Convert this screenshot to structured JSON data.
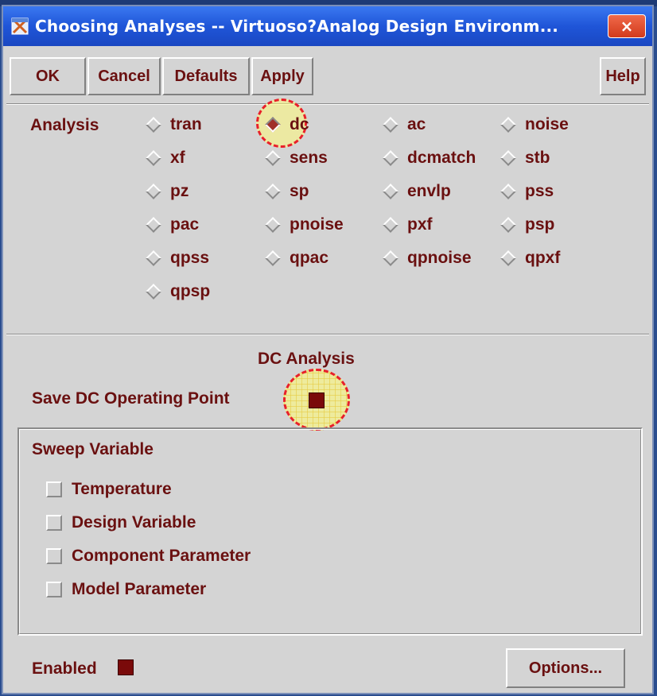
{
  "window": {
    "title": "Choosing Analyses -- Virtuoso?Analog Design Environm...",
    "close_label": "×"
  },
  "toolbar": {
    "ok": "OK",
    "cancel": "Cancel",
    "defaults": "Defaults",
    "apply": "Apply",
    "help": "Help"
  },
  "analysis": {
    "label": "Analysis",
    "selected": "dc",
    "options": [
      "tran",
      "dc",
      "ac",
      "noise",
      "xf",
      "sens",
      "dcmatch",
      "stb",
      "pz",
      "sp",
      "envlp",
      "pss",
      "pac",
      "pnoise",
      "pxf",
      "psp",
      "qpss",
      "qpac",
      "qpnoise",
      "qpxf",
      "qpsp"
    ]
  },
  "dc_section": {
    "title": "DC Analysis",
    "save_op_label": "Save DC Operating Point",
    "save_op_checked": true
  },
  "sweep": {
    "title": "Sweep Variable",
    "items": [
      "Temperature",
      "Design Variable",
      "Component Parameter",
      "Model Parameter"
    ]
  },
  "footer": {
    "enabled_label": "Enabled",
    "enabled_checked": true,
    "options_button": "Options..."
  },
  "colors": {
    "text": "#6a1010",
    "window_bg": "#d4d4d4",
    "highlight": "#fffa78",
    "highlight_border": "#e8202a"
  },
  "icons": {
    "app": "app-window-icon",
    "close": "close-icon"
  }
}
